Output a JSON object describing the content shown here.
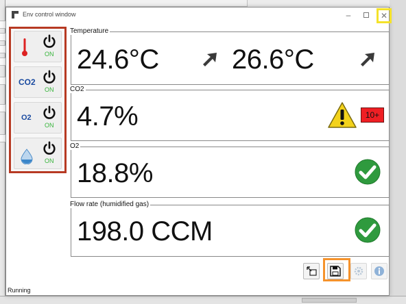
{
  "window": {
    "title": "Env control window"
  },
  "sidebar": [
    {
      "name": "temperature",
      "label": "",
      "state": "ON"
    },
    {
      "name": "co2",
      "label": "CO2",
      "state": "ON"
    },
    {
      "name": "o2",
      "label": "O2",
      "state": "ON"
    },
    {
      "name": "humidity",
      "label": "",
      "state": "ON"
    }
  ],
  "panels": {
    "temperature": {
      "title": "Temperature",
      "value": "24.6°C",
      "target": "26.6°C"
    },
    "co2": {
      "title": "CO2",
      "value": "4.7%",
      "badge": "10+"
    },
    "o2": {
      "title": "O2",
      "value": "18.8%"
    },
    "flow": {
      "title": "Flow rate (humidified gas)",
      "value": "198.0 CCM"
    }
  },
  "status": "Running",
  "colors": {
    "highlight_side": "#b73a23",
    "highlight_close": "#f4e22a",
    "highlight_save": "#f5922b",
    "on_green": "#36b43a",
    "check_green": "#2f9a3e"
  }
}
